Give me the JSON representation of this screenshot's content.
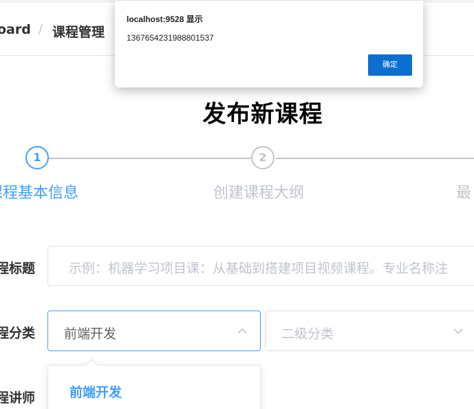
{
  "breadcrumb": {
    "items": [
      "oard",
      "课程管理"
    ],
    "separator": "/"
  },
  "page_title": "发布新课程",
  "steps": [
    {
      "number": "1",
      "title": "写课程基本信息",
      "status": "active"
    },
    {
      "number": "2",
      "title": "创建课程大纲",
      "status": "wait"
    },
    {
      "number": "3",
      "title": "最",
      "status": "wait"
    }
  ],
  "form": {
    "title_label": "程标题",
    "title_placeholder": "示例：机器学习项目课：从基础到搭建项目视频课程。专业名称注",
    "category_label": "程分类",
    "category_primary_value": "前端开发",
    "category_secondary_placeholder": "二级分类",
    "teacher_label": "程讲师"
  },
  "dropdown": {
    "options": [
      "前端开发"
    ],
    "selected": "前端开发"
  },
  "alert": {
    "title": "localhost:9528 显示",
    "message": "1367654231988801537",
    "ok_label": "确定"
  },
  "colors": {
    "primary": "#409eff",
    "inactive": "#c0c4cc",
    "alert_button": "#0b6fd0"
  }
}
